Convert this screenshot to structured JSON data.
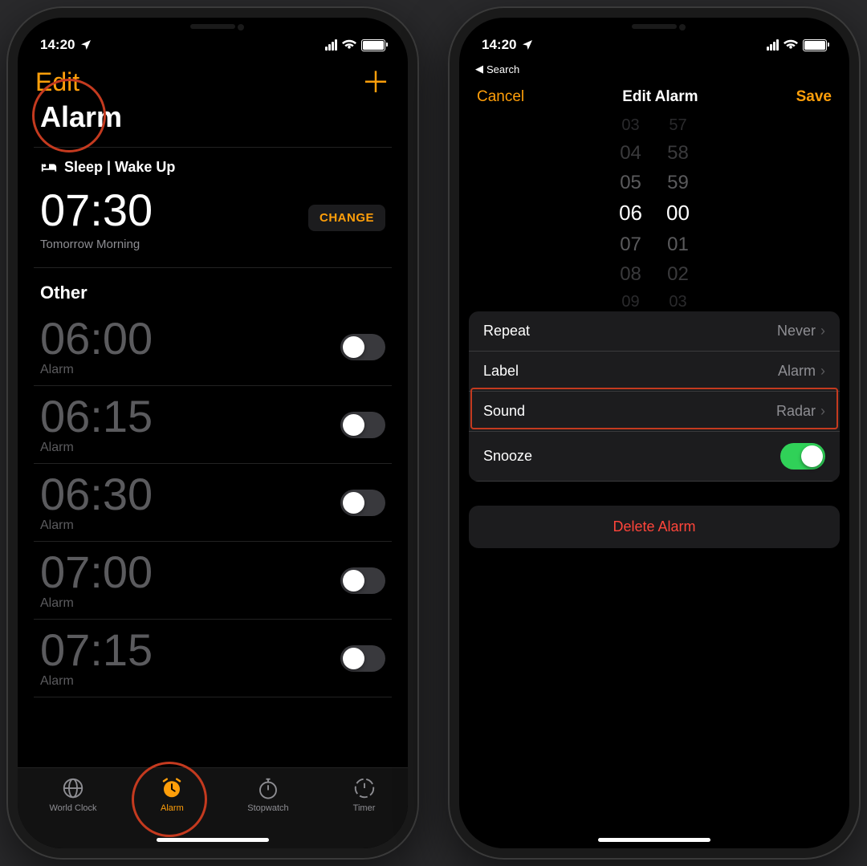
{
  "left": {
    "status_time": "14:20",
    "nav": {
      "edit": "Edit"
    },
    "title": "Alarm",
    "sleep": {
      "header": "Sleep | Wake Up",
      "time": "07:30",
      "subtitle": "Tomorrow Morning",
      "change": "CHANGE"
    },
    "other_label": "Other",
    "alarms": [
      {
        "time": "06:00",
        "label": "Alarm",
        "on": false
      },
      {
        "time": "06:15",
        "label": "Alarm",
        "on": false
      },
      {
        "time": "06:30",
        "label": "Alarm",
        "on": false
      },
      {
        "time": "07:00",
        "label": "Alarm",
        "on": false
      },
      {
        "time": "07:15",
        "label": "Alarm",
        "on": false
      }
    ],
    "tabs": [
      {
        "label": "World Clock"
      },
      {
        "label": "Alarm"
      },
      {
        "label": "Stopwatch"
      },
      {
        "label": "Timer"
      }
    ]
  },
  "right": {
    "status_time": "14:20",
    "breadcrumb": "Search",
    "nav": {
      "cancel": "Cancel",
      "title": "Edit Alarm",
      "save": "Save"
    },
    "picker": {
      "hours": [
        "03",
        "04",
        "05",
        "06",
        "07",
        "08",
        "09"
      ],
      "minutes": [
        "57",
        "58",
        "59",
        "00",
        "01",
        "02",
        "03"
      ],
      "selected_hour": "06",
      "selected_minute": "00"
    },
    "settings": {
      "repeat": {
        "label": "Repeat",
        "value": "Never"
      },
      "label": {
        "label": "Label",
        "value": "Alarm"
      },
      "sound": {
        "label": "Sound",
        "value": "Radar"
      },
      "snooze": {
        "label": "Snooze",
        "on": true
      }
    },
    "delete": "Delete Alarm"
  }
}
